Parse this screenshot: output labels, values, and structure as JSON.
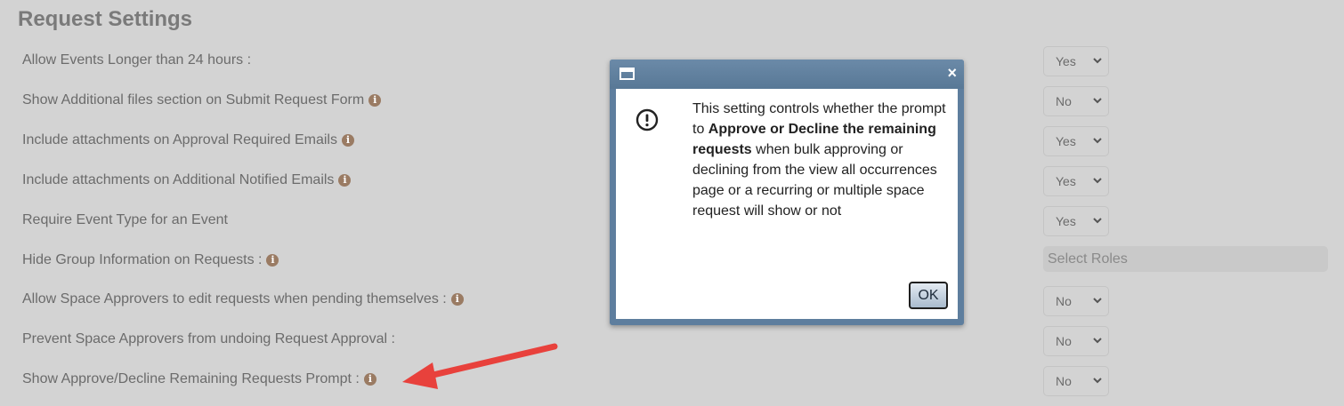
{
  "page": {
    "section_title": "Request Settings"
  },
  "settings": [
    {
      "label": "Allow Events Longer than 24 hours :",
      "info": false,
      "value": "Yes"
    },
    {
      "label": "Show Additional files section on Submit Request Form",
      "info": true,
      "value": "No"
    },
    {
      "label": "Include attachments on Approval Required Emails",
      "info": true,
      "value": "Yes"
    },
    {
      "label": "Include attachments on Additional Notified Emails",
      "info": true,
      "value": "Yes"
    },
    {
      "label": "Require Event Type for an Event",
      "info": false,
      "value": "Yes"
    },
    {
      "label": "Hide Group Information on Requests :",
      "info": true,
      "placeholder": "Select Roles"
    },
    {
      "label": "Allow Space Approvers to edit requests when pending themselves :",
      "info": true,
      "value": "No"
    },
    {
      "label": "Prevent Space Approvers from undoing Request Approval :",
      "info": false,
      "value": "No"
    },
    {
      "label": "Show Approve/Decline Remaining Requests Prompt :",
      "info": true,
      "value": "No"
    }
  ],
  "dialog": {
    "close_glyph": "×",
    "message_part1": "This setting controls whether the prompt to ",
    "message_bold": "Approve or Decline the remaining requests",
    "message_part2": " when bulk approving or declining from the view all occurrences page or a recurring or multiple space request will show or not",
    "ok_label": "OK"
  },
  "icons": {
    "info": "info-icon",
    "alert": "exclamation-circle-icon",
    "window": "window-icon",
    "chevron": "chevron-down-icon",
    "annotation_arrow": "red-arrow"
  },
  "colors": {
    "annotation_arrow": "#e8413c",
    "dialog_frame": "#5e7e9e",
    "info_icon": "#9a7b63"
  }
}
